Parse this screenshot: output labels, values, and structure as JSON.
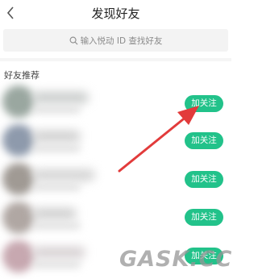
{
  "header": {
    "title": "发现好友"
  },
  "search": {
    "placeholder": "输入悦动 ID 查找好友"
  },
  "section": {
    "title": "好友推荐"
  },
  "recommendations": [
    {
      "button_label": "加关注"
    },
    {
      "button_label": "加关注"
    },
    {
      "button_label": "加关注"
    },
    {
      "button_label": "加关注"
    },
    {
      "button_label": "加关注"
    }
  ],
  "colors": {
    "accent": "#22c28a",
    "arrow": "#e23b3b"
  },
  "watermark": "GASK.CC"
}
